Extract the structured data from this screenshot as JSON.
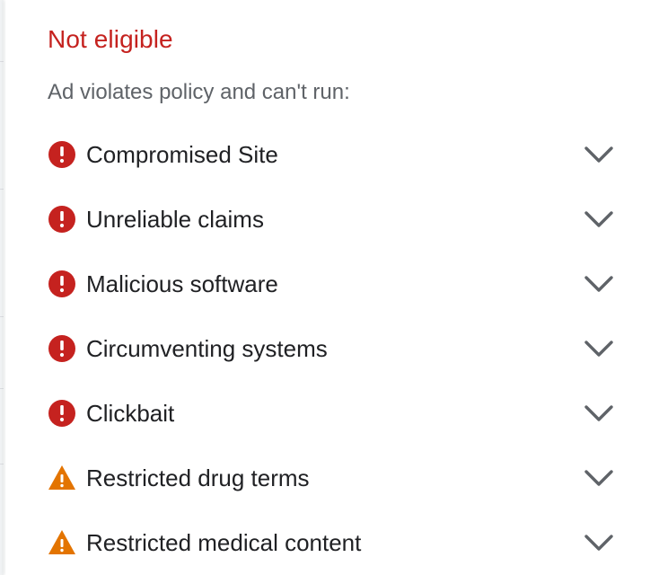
{
  "status": {
    "title": "Not eligible",
    "color": "#c5221f"
  },
  "subtitle": "Ad violates policy and can't run:",
  "policies": [
    {
      "label": "Compromised Site",
      "severity": "error",
      "icon": "error-icon"
    },
    {
      "label": "Unreliable claims",
      "severity": "error",
      "icon": "error-icon"
    },
    {
      "label": "Malicious software",
      "severity": "error",
      "icon": "error-icon"
    },
    {
      "label": "Circumventing systems",
      "severity": "error",
      "icon": "error-icon"
    },
    {
      "label": "Clickbait",
      "severity": "error",
      "icon": "error-icon"
    },
    {
      "label": "Restricted drug terms",
      "severity": "warning",
      "icon": "warning-icon"
    },
    {
      "label": "Restricted medical content",
      "severity": "warning",
      "icon": "warning-icon"
    }
  ],
  "colors": {
    "error": "#c5221f",
    "warning": "#e37400",
    "chevron": "#5f6368",
    "text": "#202124",
    "muted": "#5f6368"
  }
}
